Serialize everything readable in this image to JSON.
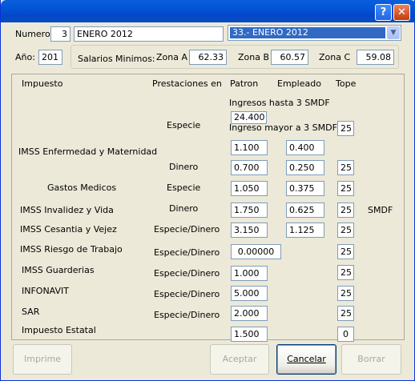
{
  "titlebar": {
    "help_glyph": "?",
    "close_glyph": "✕"
  },
  "header": {
    "numero_label": "Numero:",
    "numero_value": "3",
    "periodo_value": "ENERO 2012",
    "period_select": "33.- ENERO 2012",
    "anio_label": "Año:",
    "anio_value": "201",
    "salarios_label": "Salarios Minimos:",
    "zona_a_label": "Zona A",
    "zona_a_value": "62.33",
    "zona_b_label": "Zona B",
    "zona_b_value": "60.57",
    "zona_c_label": "Zona C",
    "zona_c_value": "59.08"
  },
  "columns": {
    "impuesto": "Impuesto",
    "prestaciones": "Prestaciones en",
    "patron": "Patron",
    "empleado": "Empleado",
    "tope": "Tope"
  },
  "rows": {
    "ingresos_hasta": "Ingresos hasta 3 SMDF",
    "ingresos_hasta_value": "24.400",
    "ingreso_mayor": "Ingreso mayor a 3 SMDF",
    "especie1": "Especie",
    "especie1_tope": "25",
    "imss_enf": "IMSS Enfermedad y Maternidad",
    "mayor_patron": "1.100",
    "mayor_empleado": "0.400",
    "dinero1": "Dinero",
    "dinero1_patron": "0.700",
    "dinero1_empleado": "0.250",
    "dinero1_tope": "25",
    "gastos": "Gastos Medicos",
    "gastos_prest": "Especie",
    "gastos_patron": "1.050",
    "gastos_empleado": "0.375",
    "gastos_tope": "25",
    "invalidez": "IMSS Invalidez y Vida",
    "invalidez_prest": "Dinero",
    "invalidez_patron": "1.750",
    "invalidez_empleado": "0.625",
    "invalidez_tope": "25",
    "smdf": "SMDF",
    "cesantia": "IMSS Cesantia y Vejez",
    "cesantia_prest": "Especie/Dinero",
    "cesantia_patron": "3.150",
    "cesantia_empleado": "1.125",
    "cesantia_tope": "25",
    "riesgo": "IMSS Riesgo de Trabajo",
    "riesgo_prest": "Especie/Dinero",
    "riesgo_patron": "0.00000",
    "riesgo_tope": "25",
    "guarderias": "IMSS Guarderias",
    "guarderias_prest": "Especie/Dinero",
    "guarderias_patron": "1.000",
    "guarderias_tope": "25",
    "infonavit": "INFONAVIT",
    "infonavit_prest": "Especie/Dinero",
    "infonavit_patron": "5.000",
    "infonavit_tope": "25",
    "sar": "SAR",
    "sar_prest": "Especie/Dinero",
    "sar_patron": "2.000",
    "sar_tope": "25",
    "estatal": "Impuesto Estatal",
    "estatal_patron": "1.500",
    "estatal_tope": "0"
  },
  "buttons": {
    "imprime": "Imprime",
    "aceptar": "Aceptar",
    "cancelar": "Cancelar",
    "borrar": "Borrar"
  }
}
